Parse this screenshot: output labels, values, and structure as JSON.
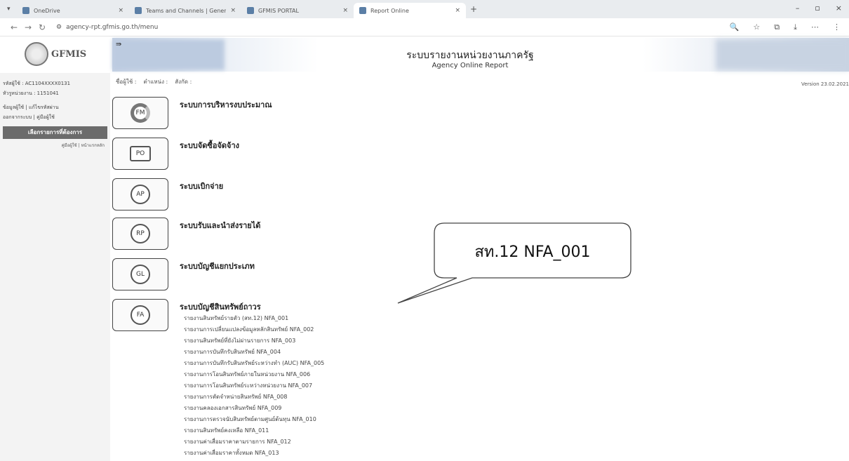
{
  "browser": {
    "tabs": [
      {
        "label": "OneDrive"
      },
      {
        "label": "Teams and Channels | General"
      },
      {
        "label": "GFMIS PORTAL"
      },
      {
        "label": "Report Online"
      }
    ],
    "new_tab": "+",
    "url": "agency-rpt.gfmis.go.th/menu"
  },
  "header": {
    "logo_text": "GFMIS",
    "title": "ระบบรายงานหน่วยงานภาครัฐ",
    "subtitle": "Agency Online Report"
  },
  "userbar": {
    "user_label": "ชื่อผู้ใช้ :",
    "position_label": "ตำแหน่ง :",
    "affiliation_label": "สังกัด :"
  },
  "sidebar": {
    "user_id_line": "รหัสผู้ใช้ : AC1104XXXX0131",
    "unit_line": "หัวรูหน่วยงาน : 1151041",
    "links_line_1": "ข้อมูลผู้ใช้ | แก้ไขรหัสผ่าน",
    "links_line_2": "ออกจากระบบ | คู่มือผู้ใช้",
    "select_button": "เลือกรายการที่ต้องการ",
    "manual_link": "คู่มือผู้ใช้ | หน้าแรกหลัก"
  },
  "version": "Version 23.02.2021",
  "modules": [
    {
      "code": "FM",
      "label": "ระบบการบริหารงบประมาณ"
    },
    {
      "code": "PO",
      "label": "ระบบจัดซื้อจัดจ้าง"
    },
    {
      "code": "AP",
      "label": "ระบบเบิกจ่าย"
    },
    {
      "code": "RP",
      "label": "ระบบรับและนำส่งรายได้"
    },
    {
      "code": "GL",
      "label": "ระบบบัญชีแยกประเภท"
    },
    {
      "code": "FA",
      "label": "ระบบบัญชีสินทรัพย์ถาวร"
    }
  ],
  "fa_reports": [
    "รายงานสินทรัพย์รายตัว (สท.12) NFA_001",
    "รายงานการเปลี่ยนแปลงข้อมูลหลักสินทรัพย์ NFA_002",
    "รายงานสินทรัพย์ที่ยังไม่ผ่านรายการ NFA_003",
    "รายงานการบันทึกรับสินทรัพย์ NFA_004",
    "รายงานการบันทึกรับสินทรัพย์ระหว่างทำ (AUC) NFA_005",
    "รายงานการโอนสินทรัพย์ภายในหน่วยงาน NFA_006",
    "รายงานการโอนสินทรัพย์ระหว่างหน่วยงาน NFA_007",
    "รายงานการตัดจำหน่ายสินทรัพย์ NFA_008",
    "รายงานคลองเอกสารสินทรัพย์ NFA_009",
    "รายงานการตรวจนับสินทรัพย์ตามศูนย์ต้นทุน NFA_010",
    "รายงานสินทรัพย์คงเหลือ NFA_011",
    "รายงานค่าเสื่อมราคาตามรายการ NFA_012",
    "รายงานค่าเสื่อมราคาทั้งหมด NFA_013"
  ],
  "callout": {
    "text": "สท.12 NFA_001"
  }
}
